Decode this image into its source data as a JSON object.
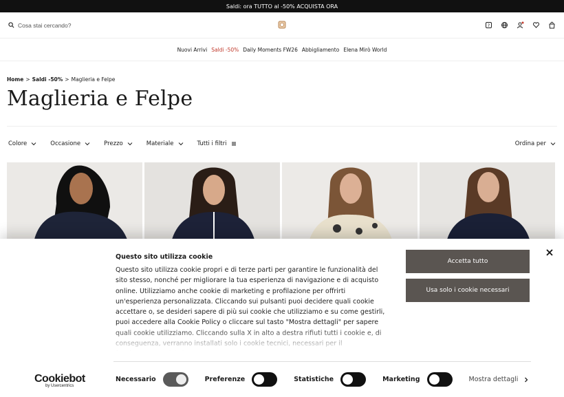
{
  "promo": {
    "text": "Saldi: ora TUTTO al -50% ACQUISTA ORA"
  },
  "header": {
    "search_placeholder": "Cosa stai cercando?",
    "icons": [
      "search-icon",
      "logo-icon",
      "support-icon",
      "globe-icon",
      "user-icon",
      "heart-icon",
      "bag-icon"
    ]
  },
  "nav": {
    "items": [
      "Nuovi Arrivi",
      "Saldi -50%",
      "Daily Moments FW26",
      "Abbigliamento",
      "Elena Mirò World"
    ]
  },
  "breadcrumb": {
    "home": "Home",
    "sep1": ">",
    "sale": "Saldi -50%",
    "sep2": ">",
    "current": "Maglieria e Felpe"
  },
  "page": {
    "title": "Maglieria e Felpe"
  },
  "filters": {
    "colore": "Colore",
    "occasione": "Occasione",
    "prezzo": "Prezzo",
    "materiale": "Materiale",
    "tutti": "Tutti i filtri",
    "ordina": "Ordina per"
  },
  "products": {
    "count_visible": 4
  },
  "cookie": {
    "title": "Questo sito utilizza cookie",
    "body": "Questo sito utilizza cookie propri e di terze parti per garantire le funzionalità del sito stesso, nonché per migliorare la tua esperienza di navigazione e di acquisto online. Utilizziamo anche cookie di marketing e profilazione per offrirti un'esperienza personalizzata. Cliccando sui pulsanti puoi decidere quali cookie accettare o, se desideri sapere di più sui cookie che utilizziamo e su come gestirli, puoi accedere alla Cookie Policy o cliccare sul tasto \"Mostra dettagli\" per sapere quali cookie utilizziamo. Cliccando sulla X in alto a destra rifiuti tutti i cookie e, di conseguenza, verranno installati solo i cookie tecnici, necessari per il funzionamento del sito.",
    "accept_all": "Accetta tutto",
    "only_necessary": "Usa solo i cookie necessari",
    "logo_main": "Cookiebot",
    "logo_sub": "by Usercentrics",
    "toggles": {
      "necessario": "Necessario",
      "preferenze": "Preferenze",
      "statistiche": "Statistiche",
      "marketing": "Marketing"
    },
    "more": "Mostra dettagli"
  },
  "colors": {
    "button": "#5a5551",
    "sale": "#c0392b",
    "promo_bg": "#111111"
  }
}
